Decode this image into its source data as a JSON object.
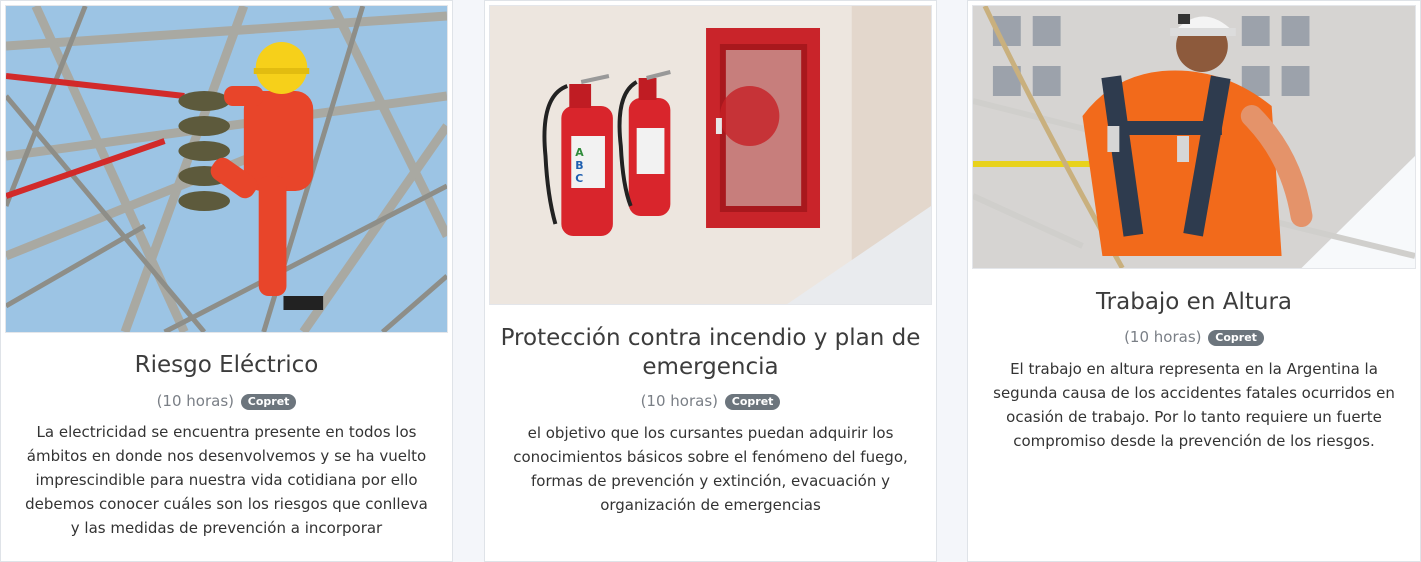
{
  "courses": [
    {
      "title": "Riesgo Eléctrico",
      "hours": "(10 horas)",
      "badge": "Copret",
      "description": "La electricidad se encuentra presente en todos los ámbitos en donde nos desenvolvemos y se ha vuelto imprescindible para nuestra vida cotidiana por ello debemos conocer cuáles son los riesgos que conlleva y las medidas de prevención a incorporar",
      "image": "electrician-on-tower-photo"
    },
    {
      "title": "Protección contra incendio y plan de emergencia",
      "hours": "(10 horas)",
      "badge": "Copret",
      "description": "el objetivo que los cursantes puedan adquirir los conocimientos básicos sobre el fenómeno del fuego, formas de prevención y extinción, evacuación y organización de emergencias",
      "image": "fire-extinguishers-photo"
    },
    {
      "title": "Trabajo en Altura",
      "hours": "(10 horas)",
      "badge": "Copret",
      "description": "El trabajo en altura representa en la Argentina la segunda causa de los accidentes fatales ocurridos en ocasión de trabajo. Por lo tanto requiere un fuerte compromiso desde la prevención de los riesgos.",
      "image": "worker-harness-photo"
    }
  ],
  "colors": {
    "page_bg": "#f4f6fa",
    "badge_bg": "#6c757d",
    "title_text": "#3c3c3c"
  }
}
